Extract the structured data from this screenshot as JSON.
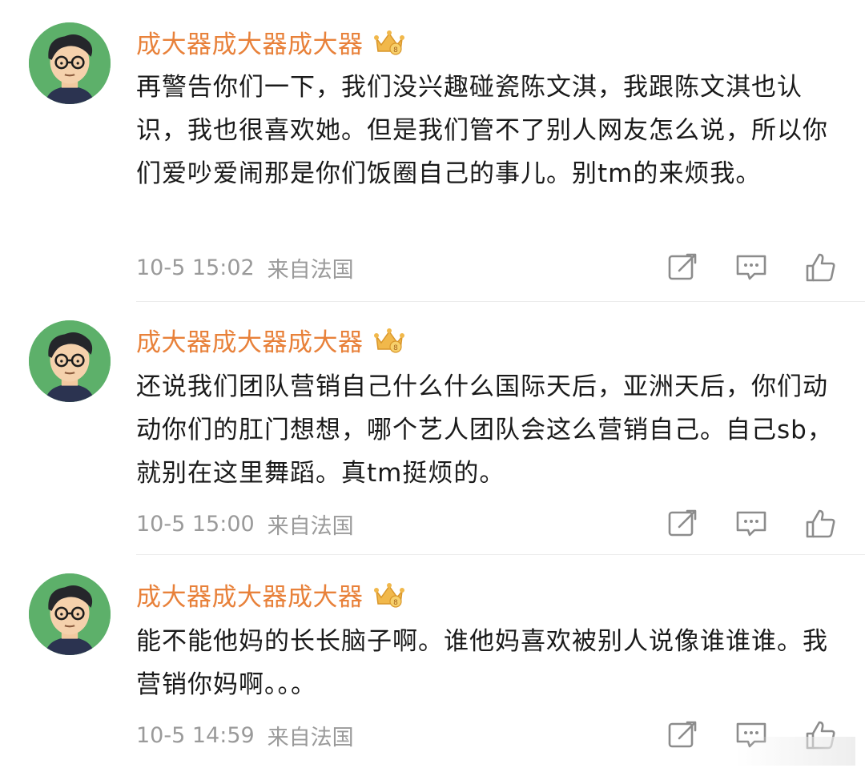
{
  "comments": [
    {
      "username": "成大器成大器成大器",
      "text": "再警告你们一下，我们没兴趣碰瓷陈文淇，我跟陈文淇也认识，我也很喜欢她。但是我们管不了别人网友怎么说，所以你们爱吵爱闹那是你们饭圈自己的事儿。别tm的来烦我。",
      "time": "10-5 15:02",
      "source": "来自法国"
    },
    {
      "username": "成大器成大器成大器",
      "text": "还说我们团队营销自己什么什么国际天后，亚洲天后，你们动动你们的肛门想想，哪个艺人团队会这么营销自己。自己sb，就别在这里舞蹈。真tm挺烦的。",
      "time": "10-5 15:00",
      "source": "来自法国"
    },
    {
      "username": "成大器成大器成大器",
      "text": "能不能他妈的长长脑子啊。谁他妈喜欢被别人说像谁谁谁。我营销你妈啊。。。",
      "time": "10-5 14:59",
      "source": "来自法国"
    }
  ],
  "icons": {
    "badge": "crown-vip-badge-icon",
    "repost": "share-icon",
    "reply": "comment-icon",
    "like": "thumbs-up-icon"
  },
  "colors": {
    "username": "#e8813a",
    "text": "#1a1a1a",
    "meta": "#9a9a9a",
    "avatar_bg": "#5db06a",
    "divider": "#ececec"
  }
}
